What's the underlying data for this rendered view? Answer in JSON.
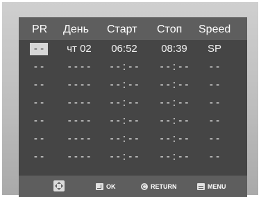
{
  "header": {
    "pr": "PR",
    "day": "День",
    "start": "Старт",
    "stop": "Стоп",
    "speed": "Speed"
  },
  "rows": [
    {
      "pr": "- -",
      "day": "чт  02",
      "start": "06:52",
      "stop": "08:39",
      "speed": "SP"
    },
    {
      "pr": "- -",
      "day": "- -  - -",
      "start": "- - : - -",
      "stop": "- - : - -",
      "speed": "- -"
    },
    {
      "pr": "- -",
      "day": "- -  - -",
      "start": "- - : - -",
      "stop": "- - : - -",
      "speed": "- -"
    },
    {
      "pr": "- -",
      "day": "- -  - -",
      "start": "- - : - -",
      "stop": "- - : - -",
      "speed": "- -"
    },
    {
      "pr": "- -",
      "day": "- -  - -",
      "start": "- - : - -",
      "stop": "- - : - -",
      "speed": "- -"
    },
    {
      "pr": "- -",
      "day": "- -  - -",
      "start": "- - : - -",
      "stop": "- - : - -",
      "speed": "- -"
    },
    {
      "pr": "- -",
      "day": "- -  - -",
      "start": "- - : - -",
      "stop": "- - : - -",
      "speed": "- -"
    }
  ],
  "footer": {
    "nav_icon": "dpad-icon",
    "ok_label": "OK",
    "return_label": "RETURN",
    "menu_label": "MENU"
  },
  "colors": {
    "screen_bg": "#454545",
    "bar_bg": "#5e5e5e",
    "frame": "#bdbdbd",
    "selection": "#d6d6d6"
  }
}
